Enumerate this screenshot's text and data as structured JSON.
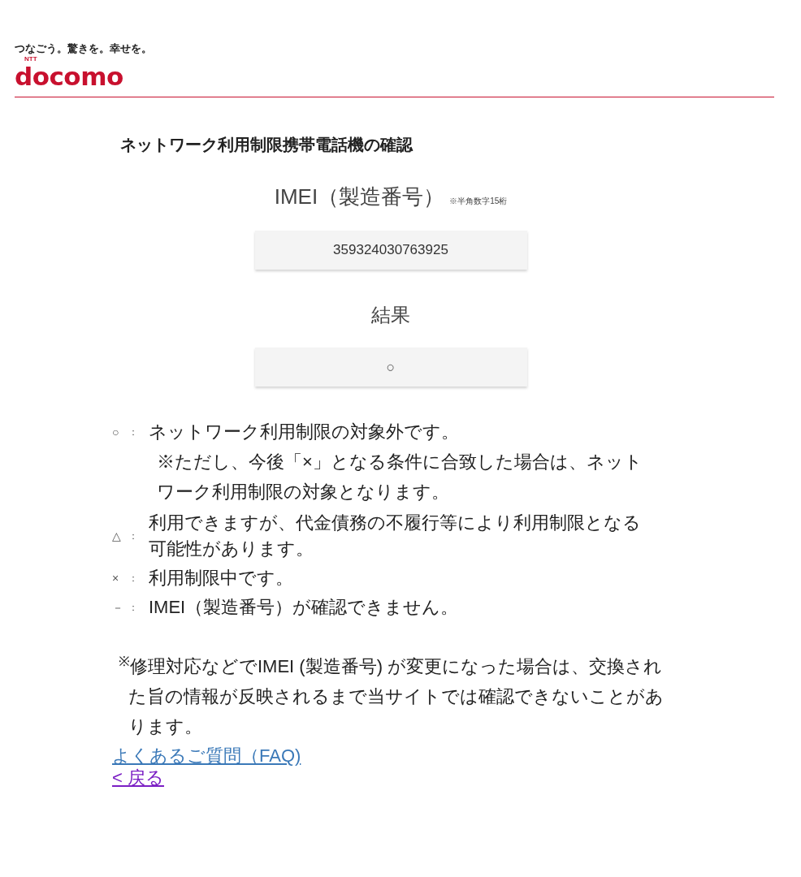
{
  "header": {
    "tagline": "つなごう。驚きを。幸せを。",
    "logo_small": "NTT",
    "logo": "docomo"
  },
  "title": "ネットワーク利用制限携帯電話機の確認",
  "imei": {
    "label": "IMEI（製造番号）",
    "hint": "※半角数字15桁",
    "value": "359324030763925"
  },
  "result": {
    "label": "結果",
    "value": "○"
  },
  "legend": [
    {
      "symbol": "○",
      "colon": "：",
      "text": "ネットワーク利用制限の対象外です。",
      "note": "※ただし、今後「×」となる条件に合致した場合は、ネットワーク利用制限の対象となります。"
    },
    {
      "symbol": "△",
      "colon": "：",
      "text": "利用できますが、代金債務の不履行等により利用制限となる可能性があります。"
    },
    {
      "symbol": "×",
      "colon": "：",
      "text": "利用制限中です。"
    },
    {
      "symbol": "－",
      "colon": "：",
      "text": "IMEI（製造番号）が確認できません。"
    }
  ],
  "notice": "$^{※}$修理対応などでIMEI (製造番号) が変更になった場合は、交換された旨の情報が反映されるまで当サイトでは確認できないことがあります。",
  "links": [
    {
      "label": "よくあるご質問（FAQ)",
      "visited": false
    },
    {
      "label": "< 戻る",
      "visited": true
    }
  ]
}
